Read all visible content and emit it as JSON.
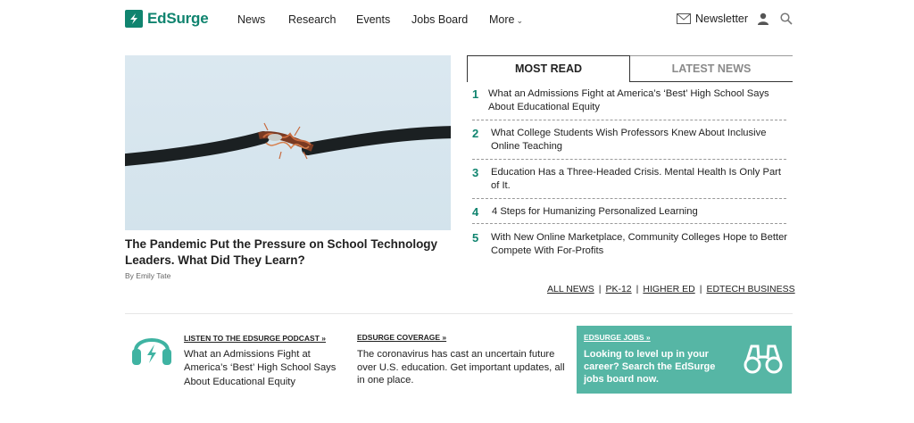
{
  "header": {
    "logo_text": "EdSurge",
    "nav": [
      "News",
      "Research",
      "Events",
      "Jobs Board",
      "More"
    ],
    "newsletter_label": "Newsletter"
  },
  "hero": {
    "title": "The Pandemic Put the Pressure on School Technology Leaders. What Did They Learn?",
    "byline": "By Emily Tate"
  },
  "tabs": {
    "most_read": "MOST READ",
    "latest_news": "LATEST NEWS"
  },
  "most_read": [
    {
      "num": "1",
      "text": "What an Admissions Fight at America’s ‘Best’ High School Says About Educational Equity"
    },
    {
      "num": "2",
      "text": "What College Students Wish Professors Knew About Inclusive Online Teaching"
    },
    {
      "num": "3",
      "text": "Education Has a Three-Headed Crisis. Mental Health Is Only Part of It."
    },
    {
      "num": "4",
      "text": "4 Steps for Humanizing Personalized Learning"
    },
    {
      "num": "5",
      "text": "With New Online Marketplace, Community Colleges Hope to Better Compete With For-Profits"
    }
  ],
  "category_links": [
    "ALL NEWS",
    "PK-12",
    "HIGHER ED",
    "EDTECH BUSINESS"
  ],
  "podcast": {
    "label": "LISTEN TO THE EDSURGE PODCAST »",
    "text": "What an Admissions Fight at America’s ‘Best’ High School Says About Educational Equity"
  },
  "coverage": {
    "label": "EDSURGE COVERAGE »",
    "text": "The coronavirus has cast an uncertain future over U.S. education. Get important updates, all in one place."
  },
  "jobs": {
    "label": "EDSURGE JOBS »",
    "text": "Looking to level up in your career? Search the EdSurge jobs board now."
  },
  "colors": {
    "brand": "#10846f",
    "jobs_bg": "#56b6a5",
    "podcast_icon": "#3fb3a2"
  },
  "icons": [
    "edsurge-logo-icon",
    "envelope-icon",
    "user-icon",
    "search-icon",
    "headphones-icon",
    "binoculars-icon",
    "chevron-down-icon"
  ]
}
